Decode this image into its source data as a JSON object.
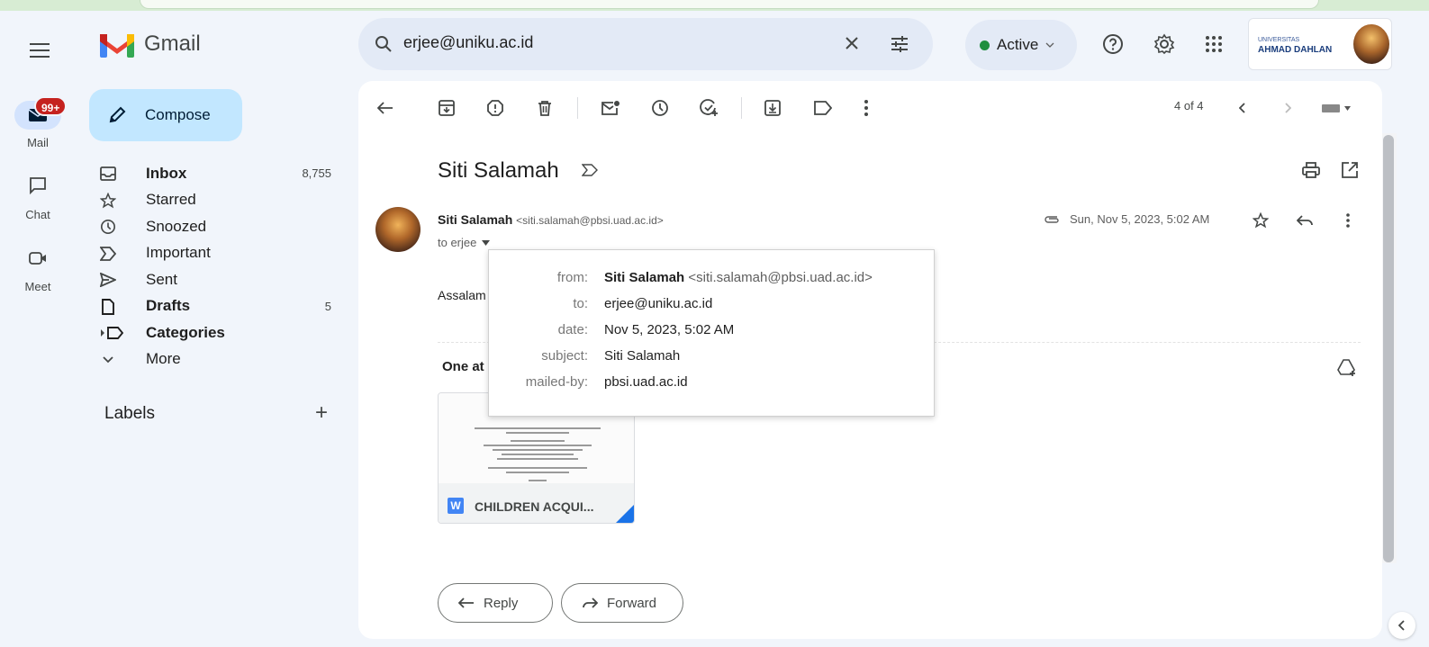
{
  "app": {
    "name": "Gmail"
  },
  "search": {
    "value": "erjee@uniku.ac.id"
  },
  "status": {
    "label": "Active"
  },
  "account": {
    "org_small": "UNIVERSITAS",
    "org_name": "AHMAD DAHLAN"
  },
  "rail": {
    "mail_label": "Mail",
    "mail_badge": "99+",
    "chat_label": "Chat",
    "meet_label": "Meet"
  },
  "compose": {
    "label": "Compose"
  },
  "nav": {
    "items": [
      {
        "label": "Inbox",
        "count": "8,755"
      },
      {
        "label": "Starred",
        "count": ""
      },
      {
        "label": "Snoozed",
        "count": ""
      },
      {
        "label": "Important",
        "count": ""
      },
      {
        "label": "Sent",
        "count": ""
      },
      {
        "label": "Drafts",
        "count": "5"
      },
      {
        "label": "Categories",
        "count": ""
      },
      {
        "label": "More",
        "count": ""
      }
    ],
    "labels_heading": "Labels",
    "labels_add": "+"
  },
  "toolbar": {
    "pager": "4 of 4"
  },
  "message": {
    "subject": "Siti Salamah",
    "sender_name": "Siti Salamah",
    "sender_email": "<siti.salamah@pbsi.uad.ac.id>",
    "to_line": "to erjee",
    "date": "Sun, Nov 5, 2023, 5:02 AM",
    "body_preview": "Assalam",
    "attachments_title": "One at",
    "attachment_name": "CHILDREN ACQUI...",
    "attachment_type": "W"
  },
  "details_popup": {
    "from_key": "from:",
    "from_name": "Siti Salamah",
    "from_email": "<siti.salamah@pbsi.uad.ac.id>",
    "to_key": "to:",
    "to_value": "erjee@uniku.ac.id",
    "date_key": "date:",
    "date_value": "Nov 5, 2023, 5:02 AM",
    "subject_key": "subject:",
    "subject_value": "Siti Salamah",
    "mailedby_key": "mailed-by:",
    "mailedby_value": "pbsi.uad.ac.id"
  },
  "actions": {
    "reply": "Reply",
    "forward": "Forward"
  },
  "colors": {
    "accent": "#c2e7ff",
    "active_dot": "#1e8e3e",
    "badge": "#c5221f",
    "background": "#f1f5fb"
  }
}
